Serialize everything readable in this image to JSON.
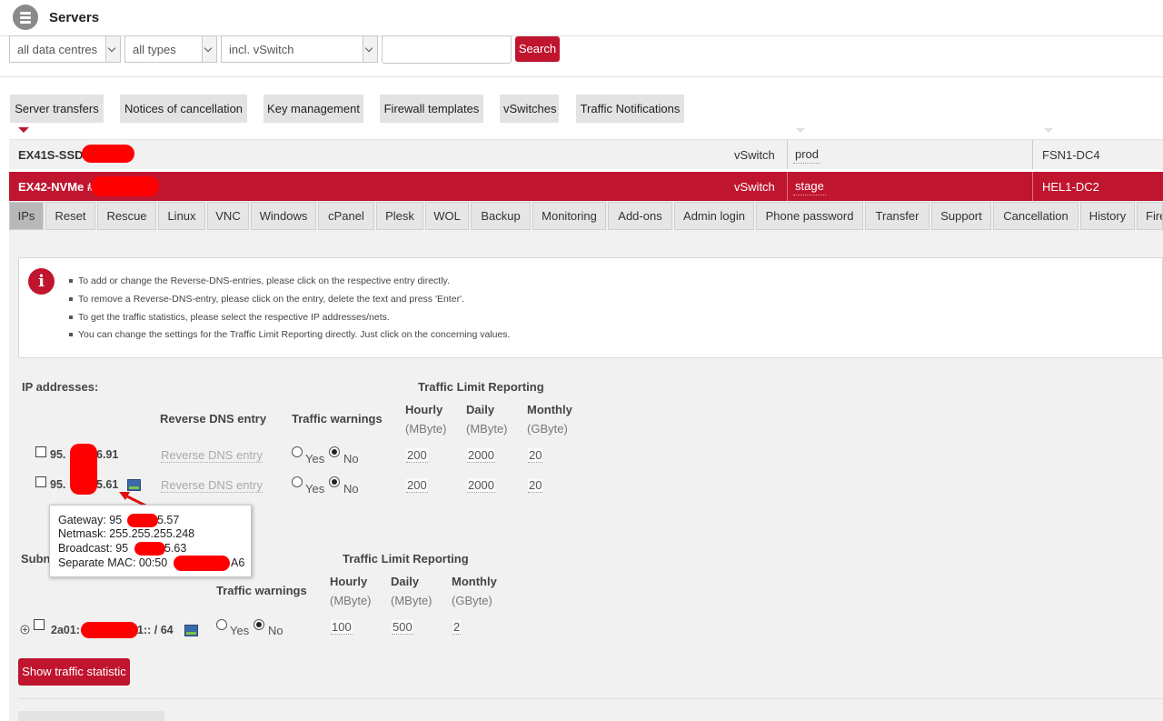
{
  "header": {
    "title": "Servers",
    "icon": "server-list-icon"
  },
  "filters": {
    "datacentre": "all data centres",
    "type": "all types",
    "vswitch": "incl. vSwitch",
    "search_value": "",
    "search_button": "Search"
  },
  "nav_buttons": [
    "Server transfers",
    "Notices of cancellation",
    "Key management",
    "Firewall templates",
    "vSwitches",
    "Traffic Notifications"
  ],
  "servers": [
    {
      "name": "EX41S-SSD",
      "vswitch_label": "vSwitch",
      "vswitch": "prod",
      "dc": "FSN1-DC4"
    },
    {
      "name": "EX42-NVMe #",
      "vswitch_label": "vSwitch",
      "vswitch": "stage",
      "dc": "HEL1-DC2"
    }
  ],
  "tabs": [
    "IPs",
    "Reset",
    "Rescue",
    "Linux",
    "VNC",
    "Windows",
    "cPanel",
    "Plesk",
    "WOL",
    "Backup",
    "Monitoring",
    "Add-ons",
    "Admin login",
    "Phone password",
    "Transfer",
    "Support",
    "Cancellation",
    "History",
    "Fire"
  ],
  "info": [
    "To add or change the Reverse-DNS-entries, please click on the respective entry directly.",
    "To remove a Reverse-DNS-entry, please click on the entry, delete the text and press 'Enter'.",
    "To get the traffic statistics, please select the respective IP addresses/nets.",
    "You can change the settings for the Traffic Limit Reporting directly. Just click on the concerning values."
  ],
  "ip_section": {
    "title": "IP addresses:",
    "tlr": "Traffic Limit Reporting",
    "col_rdns": "Reverse DNS entry",
    "col_tw": "Traffic warnings",
    "hourly": "Hourly",
    "hourly_unit": "(MByte)",
    "daily": "Daily",
    "daily_unit": "(MByte)",
    "monthly": "Monthly",
    "monthly_unit": "(GByte)",
    "rows": [
      {
        "ip_a": "95.",
        "ip_b": "6.91",
        "rdns": "Reverse DNS entry",
        "yes": "Yes",
        "no": "No",
        "hourly": "200",
        "daily": "2000",
        "monthly": "20"
      },
      {
        "ip_a": "95.",
        "ip_b": "5.61",
        "rdns": "Reverse DNS entry",
        "yes": "Yes",
        "no": "No",
        "hourly": "200",
        "daily": "2000",
        "monthly": "20"
      }
    ]
  },
  "tooltip": {
    "gateway_a": "Gateway: 95",
    "gateway_b": "5.57",
    "netmask": "Netmask: 255.255.255.248",
    "broadcast_a": "Broadcast: 95",
    "broadcast_b": "5.63",
    "mac_a": "Separate MAC: 00:50",
    "mac_b": "A6"
  },
  "subnet_section": {
    "title": "Subn",
    "tlr": "Traffic Limit Reporting",
    "col_tw": "Traffic warnings",
    "hourly": "Hourly",
    "hourly_unit": "(MByte)",
    "daily": "Daily",
    "daily_unit": "(MByte)",
    "monthly": "Monthly",
    "monthly_unit": "(GByte)",
    "row": {
      "ip_a": "2a01:",
      "ip_b": "1:: / 64",
      "yes": "Yes",
      "no": "No",
      "hourly": "100",
      "daily": "500",
      "monthly": "2"
    }
  },
  "show_traffic_button": "Show traffic statistic",
  "colors": {
    "accent": "#c0152f",
    "bg": "#f1f1f1"
  }
}
